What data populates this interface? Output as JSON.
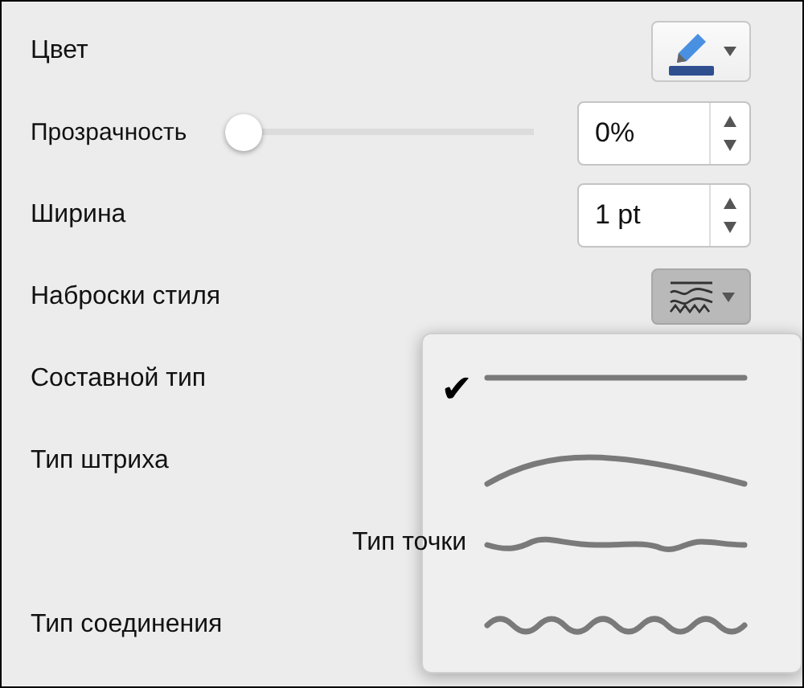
{
  "rows": [
    {
      "kind": "color",
      "label": "Цвет"
    },
    {
      "kind": "slider",
      "label": "Прозрачность",
      "level": 0,
      "value": "0%"
    },
    {
      "kind": "spinner",
      "label": "Ширина",
      "value": "1 pt"
    },
    {
      "kind": "sketch",
      "label": "Наброски стиля"
    },
    {
      "kind": "plain",
      "label": "Составной тип"
    },
    {
      "kind": "plain",
      "label": "Тип штриха"
    },
    {
      "kind": "indented",
      "label": "Тип точки"
    },
    {
      "kind": "plain",
      "label": "Тип соединения"
    }
  ],
  "sketch_menu_check": "✔",
  "sketch_menu": [
    {
      "kind": "straight",
      "selected": true
    },
    {
      "kind": "curve",
      "selected": false
    },
    {
      "kind": "scribble",
      "selected": false
    },
    {
      "kind": "wave",
      "selected": false
    }
  ]
}
